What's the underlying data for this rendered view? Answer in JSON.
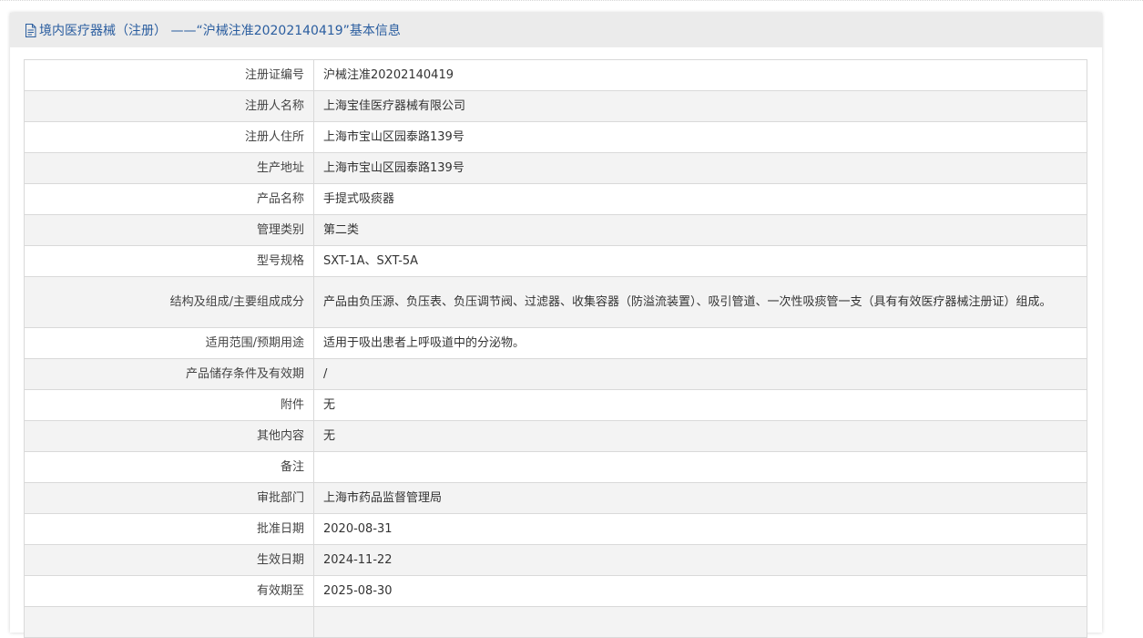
{
  "header": {
    "title": "境内医疗器械（注册） ——“沪械注准20202140419”基本信息"
  },
  "rows": [
    {
      "label": "注册证编号",
      "value": "沪械注准20202140419"
    },
    {
      "label": "注册人名称",
      "value": "上海宝佳医疗器械有限公司"
    },
    {
      "label": "注册人住所",
      "value": "上海市宝山区园泰路139号"
    },
    {
      "label": "生产地址",
      "value": "上海市宝山区园泰路139号"
    },
    {
      "label": "产品名称",
      "value": "手提式吸痰器"
    },
    {
      "label": "管理类别",
      "value": "第二类"
    },
    {
      "label": "型号规格",
      "value": "SXT-1A、SXT-5A"
    },
    {
      "label": "结构及组成/主要组成成分",
      "value": "产品由负压源、负压表、负压调节阀、过滤器、收集容器（防溢流装置）、吸引管道、一次性吸痰管一支（具有有效医疗器械注册证）组成。"
    },
    {
      "label": "适用范围/预期用途",
      "value": "适用于吸出患者上呼吸道中的分泌物。"
    },
    {
      "label": "产品储存条件及有效期",
      "value": "/"
    },
    {
      "label": "附件",
      "value": "无"
    },
    {
      "label": "其他内容",
      "value": "无"
    },
    {
      "label": "备注",
      "value": ""
    },
    {
      "label": "审批部门",
      "value": "上海市药品监督管理局"
    },
    {
      "label": "批准日期",
      "value": "2020-08-31"
    },
    {
      "label": "生效日期",
      "value": "2024-11-22"
    },
    {
      "label": "有效期至",
      "value": "2025-08-30"
    },
    {
      "label": "",
      "value": ""
    }
  ]
}
